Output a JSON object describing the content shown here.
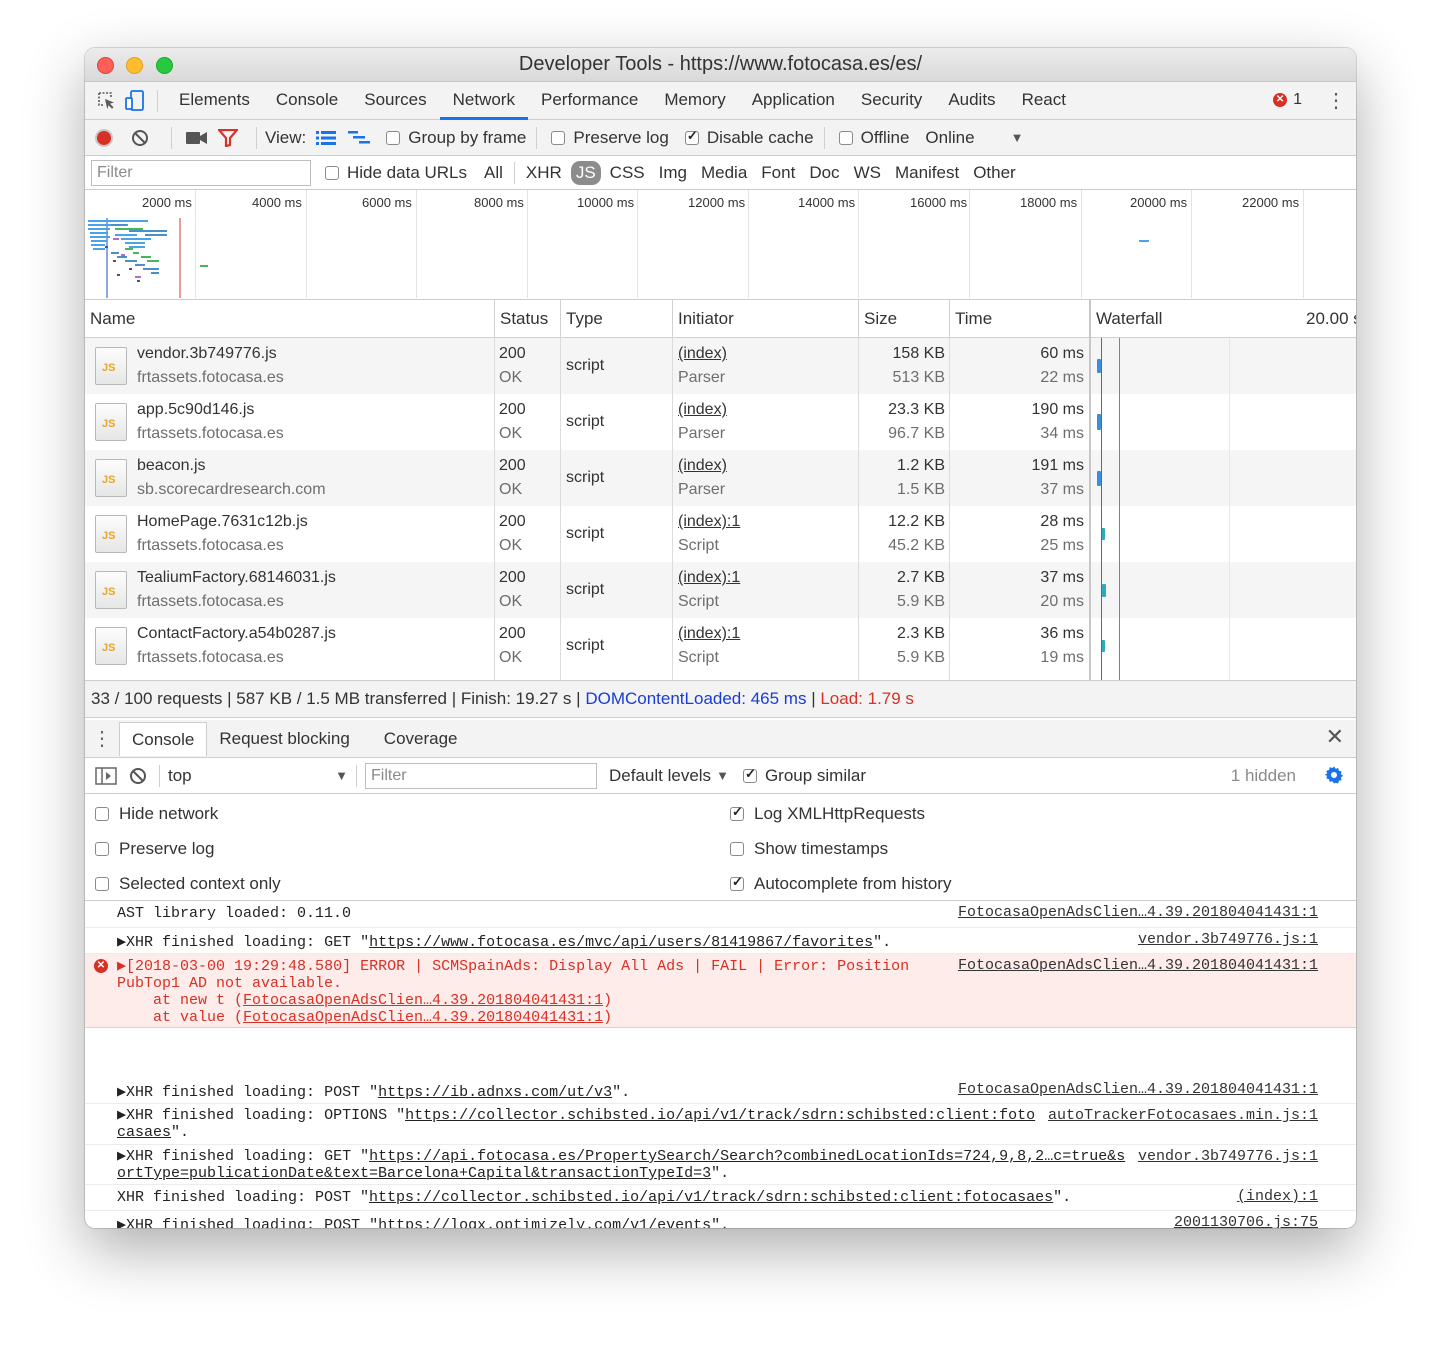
{
  "window": {
    "title": "Developer Tools - https://www.fotocasa.es/es/"
  },
  "panels": {
    "tabs": [
      "Elements",
      "Console",
      "Sources",
      "Network",
      "Performance",
      "Memory",
      "Application",
      "Security",
      "Audits",
      "React"
    ],
    "active": "Network",
    "error_count": "1"
  },
  "toolbar": {
    "view_label": "View:",
    "group_by_frame": "Group by frame",
    "preserve_log": "Preserve log",
    "disable_cache": "Disable cache",
    "offline": "Offline",
    "throttle": "Online"
  },
  "filterbar": {
    "placeholder": "Filter",
    "hide_data_urls": "Hide data URLs",
    "types": [
      "All",
      "XHR",
      "JS",
      "CSS",
      "Img",
      "Media",
      "Font",
      "Doc",
      "WS",
      "Manifest",
      "Other"
    ],
    "active_type": "JS"
  },
  "overview": {
    "ticks": [
      "2000 ms",
      "4000 ms",
      "6000 ms",
      "8000 ms",
      "10000 ms",
      "12000 ms",
      "14000 ms",
      "16000 ms",
      "18000 ms",
      "20000 ms",
      "22000 ms"
    ]
  },
  "network": {
    "headers": {
      "name": "Name",
      "status": "Status",
      "type": "Type",
      "initiator": "Initiator",
      "size": "Size",
      "time": "Time",
      "waterfall": "Waterfall",
      "waterfall_scale": "20.00 s"
    },
    "rows": [
      {
        "name": "vendor.3b749776.js",
        "domain": "frtassets.fotocasa.es",
        "status": "200",
        "status_text": "OK",
        "type": "script",
        "initiator": "(index)",
        "initiator_type": "Parser",
        "size": "158 KB",
        "resource": "513 KB",
        "time": "60 ms",
        "latency": "22 ms"
      },
      {
        "name": "app.5c90d146.js",
        "domain": "frtassets.fotocasa.es",
        "status": "200",
        "status_text": "OK",
        "type": "script",
        "initiator": "(index)",
        "initiator_type": "Parser",
        "size": "23.3 KB",
        "resource": "96.7 KB",
        "time": "190 ms",
        "latency": "34 ms"
      },
      {
        "name": "beacon.js",
        "domain": "sb.scorecardresearch.com",
        "status": "200",
        "status_text": "OK",
        "type": "script",
        "initiator": "(index)",
        "initiator_type": "Parser",
        "size": "1.2 KB",
        "resource": "1.5 KB",
        "time": "191 ms",
        "latency": "37 ms"
      },
      {
        "name": "HomePage.7631c12b.js",
        "domain": "frtassets.fotocasa.es",
        "status": "200",
        "status_text": "OK",
        "type": "script",
        "initiator": "(index):1",
        "initiator_type": "Script",
        "size": "12.2 KB",
        "resource": "45.2 KB",
        "time": "28 ms",
        "latency": "25 ms"
      },
      {
        "name": "TealiumFactory.68146031.js",
        "domain": "frtassets.fotocasa.es",
        "status": "200",
        "status_text": "OK",
        "type": "script",
        "initiator": "(index):1",
        "initiator_type": "Script",
        "size": "2.7 KB",
        "resource": "5.9 KB",
        "time": "37 ms",
        "latency": "20 ms"
      },
      {
        "name": "ContactFactory.a54b0287.js",
        "domain": "frtassets.fotocasa.es",
        "status": "200",
        "status_text": "OK",
        "type": "script",
        "initiator": "(index):1",
        "initiator_type": "Script",
        "size": "2.3 KB",
        "resource": "5.9 KB",
        "time": "36 ms",
        "latency": "19 ms"
      }
    ]
  },
  "summary": {
    "requests": "33 / 100 requests",
    "transferred": "587 KB / 1.5 MB transferred",
    "finish": "Finish: 19.27 s",
    "dcl": "DOMContentLoaded: 465 ms",
    "load": "Load: 1.79 s",
    "sep": "|"
  },
  "drawer": {
    "tabs": [
      "Console",
      "Request blocking",
      "Coverage"
    ],
    "active": "Console"
  },
  "console_toolbar": {
    "context": "top",
    "filter_placeholder": "Filter",
    "levels": "Default levels",
    "group_similar": "Group similar",
    "hidden": "1 hidden"
  },
  "console_settings": {
    "hide_network": "Hide network",
    "preserve_log": "Preserve log",
    "selected_context": "Selected context only",
    "log_xhr": "Log XMLHttpRequests",
    "show_timestamps": "Show timestamps",
    "autocomplete": "Autocomplete from history"
  },
  "console_messages": {
    "m1": {
      "text": "AST library loaded: 0.11.0",
      "source": "FotocasaOpenAdsClien…4.39.201804041431:1"
    },
    "m2": {
      "prefix": "▶XHR finished loading: GET \"",
      "url": "https://www.fotocasa.es/mvc/api/users/81419867/favorites",
      "suffix": "\".",
      "source": "vendor.3b749776.js:1"
    },
    "m3": {
      "line1": "▶[2018-03-00 19:29:48.580] ERROR | SCMSpainAds: Display All Ads | FAIL | Error: Position",
      "line2": "PubTop1 AD not available.",
      "at1_prefix": "    at new t (",
      "at1_link": "FotocasaOpenAdsClien…4.39.201804041431:1",
      "at2_prefix": "    at value (",
      "at2_link": "FotocasaOpenAdsClien…4.39.201804041431:1",
      "close": ")",
      "source": "FotocasaOpenAdsClien…4.39.201804041431:1"
    },
    "m4": {
      "prefix": "▶XHR finished loading: POST \"",
      "url": "https://ib.adnxs.com/ut/v3",
      "suffix": "\".",
      "source": "FotocasaOpenAdsClien…4.39.201804041431:1"
    },
    "m5": {
      "prefix": "▶XHR finished loading: OPTIONS \"",
      "url1": "https://collector.schibsted.io/api/v1/track/sdrn:schibsted:client:foto",
      "url2": "casaes",
      "suffix": "\".",
      "source": "autoTrackerFotocasaes.min.js:1"
    },
    "m6": {
      "prefix": "▶XHR finished loading: GET \"",
      "url1": "https://api.fotocasa.es/PropertySearch/Search?combinedLocationIds=724,9,8,2…c=true&s",
      "url2": "ortType=publicationDate&text=Barcelona+Capital&transactionTypeId=3",
      "suffix": "\".",
      "source": "vendor.3b749776.js:1"
    },
    "m7": {
      "prefix": "XHR finished loading: POST \"",
      "url": "https://collector.schibsted.io/api/v1/track/sdrn:schibsted:client:fotocasaes",
      "suffix": "\".",
      "source": "(index):1"
    },
    "m8": {
      "prefix": "▶XHR finished loading: POST \"",
      "url": "https://logx.optimizely.com/v1/events",
      "suffix": "\".",
      "source": "2001130706.js:75"
    },
    "prompt": "›"
  }
}
